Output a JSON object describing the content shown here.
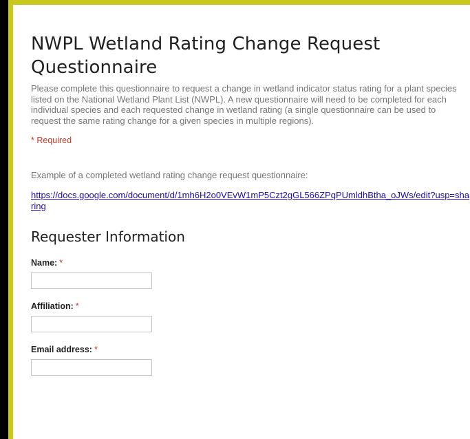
{
  "form": {
    "title": "NWPL Wetland Rating Change Request Questionnaire",
    "description": "Please complete this questionnaire to request a change in wetland indicator status rating for a plant species listed on the National Wetland Plant List (NWPL).  A new questionnaire will need to be completed for each individual species and each requested change in wetland rating (a single questionnaire can be used to request the same rating change for a given species in multiple regions).",
    "required_note": "* Required",
    "example_text": "Example of a completed wetland rating change request questionnaire:",
    "example_link": "https://docs.google.com/document/d/1mh6H2o0VEvW1mP5Czt2gGL566ZPqPUmldhBtha_oJWs/edit?usp=sharing"
  },
  "section": {
    "title": "Requester Information"
  },
  "fields": [
    {
      "label": "Name:",
      "required_mark": "*",
      "value": ""
    },
    {
      "label": "Affiliation:",
      "required_mark": "*",
      "value": ""
    },
    {
      "label": "Email address:",
      "required_mark": "*",
      "value": ""
    }
  ],
  "colors": {
    "accent_border": "#c8c81e",
    "required": "#c53929",
    "link": "#1a0dab",
    "muted_text": "#757575"
  }
}
